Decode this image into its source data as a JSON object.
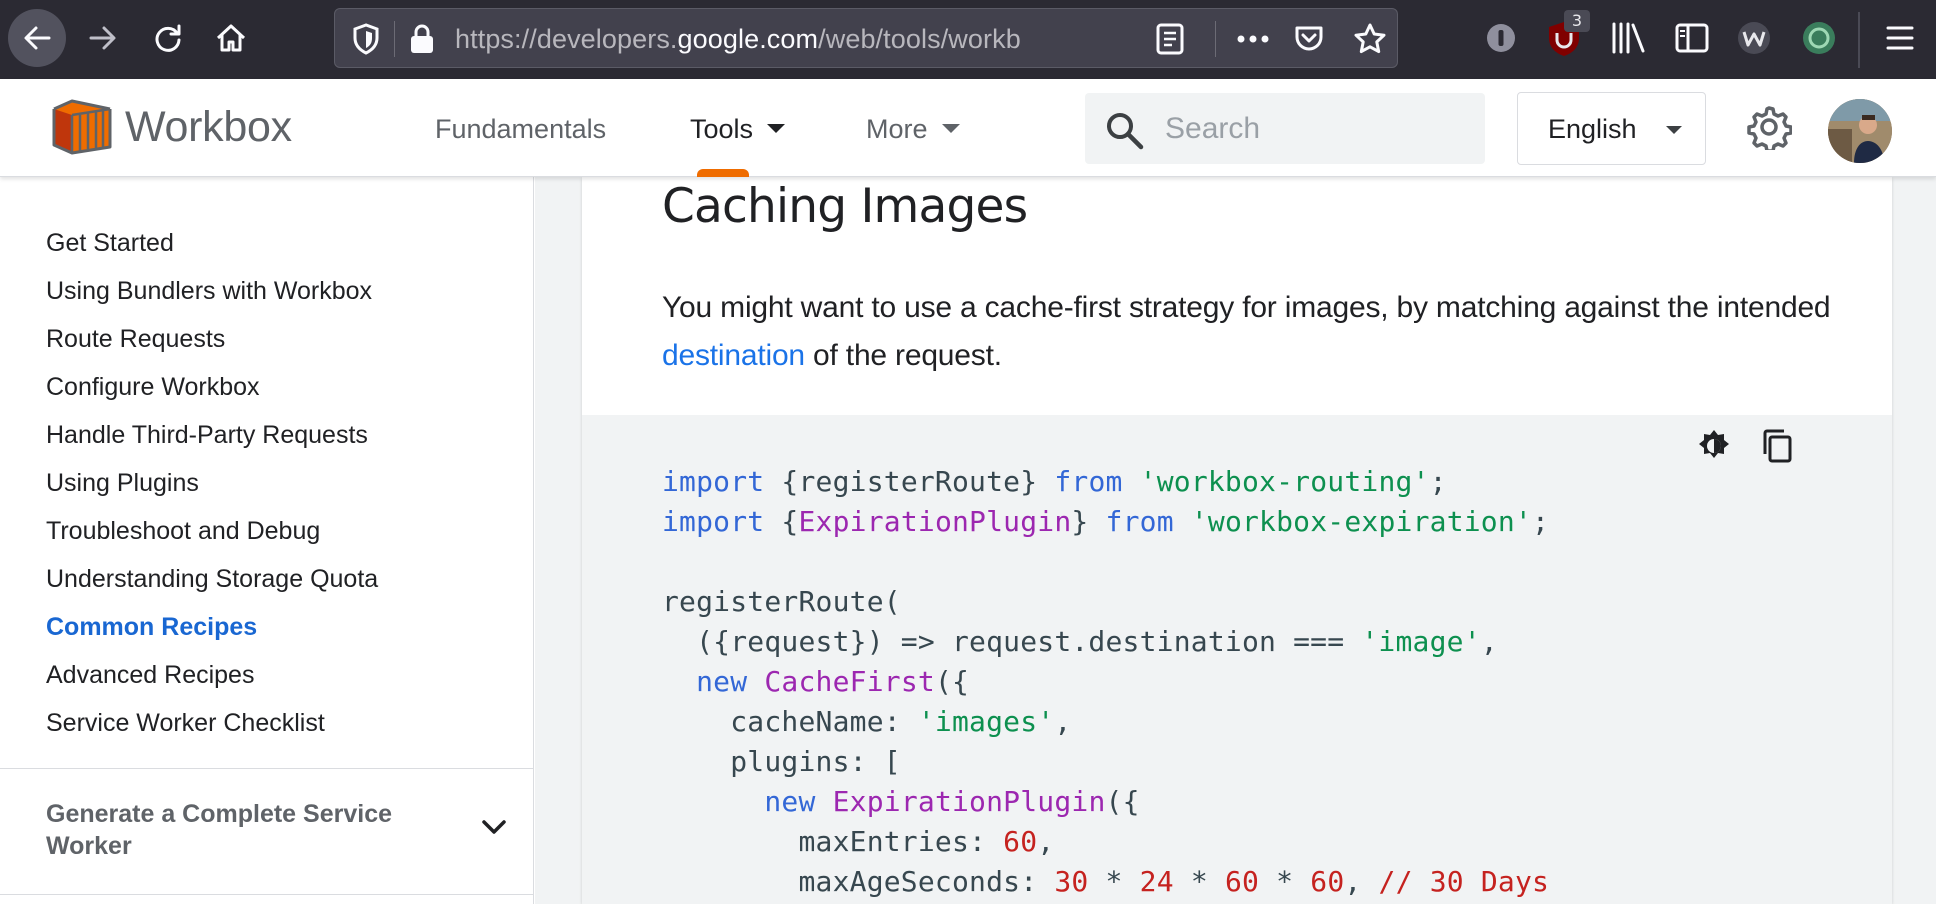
{
  "browser": {
    "url_prefix": "https://developers.",
    "url_host": "google.com",
    "url_path": "/web/tools/workbox/guides/common-recipes",
    "extension_badge": "3"
  },
  "site": {
    "brand": "Workbox",
    "nav": {
      "fundamentals": "Fundamentals",
      "tools": "Tools",
      "more": "More"
    },
    "search_placeholder": "Search",
    "language": "English",
    "accent_color": "#ef6c00"
  },
  "sidebar": {
    "items": [
      {
        "label": "Get Started"
      },
      {
        "label": "Using Bundlers with Workbox"
      },
      {
        "label": "Route Requests"
      },
      {
        "label": "Configure Workbox"
      },
      {
        "label": "Handle Third-Party Requests"
      },
      {
        "label": "Using Plugins"
      },
      {
        "label": "Troubleshoot and Debug"
      },
      {
        "label": "Understanding Storage Quota"
      },
      {
        "label": "Common Recipes"
      },
      {
        "label": "Advanced Recipes"
      },
      {
        "label": "Service Worker Checklist"
      }
    ],
    "active_index": 8,
    "section_label": "Generate a Complete Service Worker"
  },
  "article": {
    "title": "Caching Images",
    "para_before": "You might want to use a cache-first strategy for images, by matching against the intended ",
    "para_link": "destination",
    "para_after": " of the request."
  },
  "code": {
    "lines": [
      [
        [
          "kw",
          "import"
        ],
        [
          "",
          " {registerRoute} "
        ],
        [
          "kw",
          "from"
        ],
        [
          "",
          " "
        ],
        [
          "str",
          "'workbox-routing'"
        ],
        [
          "",
          ";"
        ]
      ],
      [
        [
          "kw",
          "import"
        ],
        [
          "",
          " {"
        ],
        [
          "cls",
          "ExpirationPlugin"
        ],
        [
          "",
          "} "
        ],
        [
          "kw",
          "from"
        ],
        [
          "",
          " "
        ],
        [
          "str",
          "'workbox-expiration'"
        ],
        [
          "",
          ";"
        ]
      ],
      [],
      [
        [
          "",
          "registerRoute("
        ]
      ],
      [
        [
          "",
          "  ({request}) => request.destination === "
        ],
        [
          "str",
          "'image'"
        ],
        [
          "",
          ","
        ]
      ],
      [
        [
          "kw",
          "  new"
        ],
        [
          "",
          " "
        ],
        [
          "cls",
          "CacheFirst"
        ],
        [
          "",
          "({"
        ]
      ],
      [
        [
          "",
          "    cacheName: "
        ],
        [
          "str",
          "'images'"
        ],
        [
          "",
          ","
        ]
      ],
      [
        [
          "",
          "    plugins: ["
        ]
      ],
      [
        [
          "kw",
          "      new"
        ],
        [
          "",
          " "
        ],
        [
          "cls",
          "ExpirationPlugin"
        ],
        [
          "",
          "({"
        ]
      ],
      [
        [
          "",
          "        maxEntries: "
        ],
        [
          "num",
          "60"
        ],
        [
          "",
          ","
        ]
      ],
      [
        [
          "",
          "        maxAgeSeconds: "
        ],
        [
          "num",
          "30"
        ],
        [
          "",
          " * "
        ],
        [
          "num",
          "24"
        ],
        [
          "",
          " * "
        ],
        [
          "num",
          "60"
        ],
        [
          "",
          " * "
        ],
        [
          "num",
          "60"
        ],
        [
          "",
          ", "
        ],
        [
          "cmt",
          "// 30 Days"
        ]
      ]
    ]
  }
}
